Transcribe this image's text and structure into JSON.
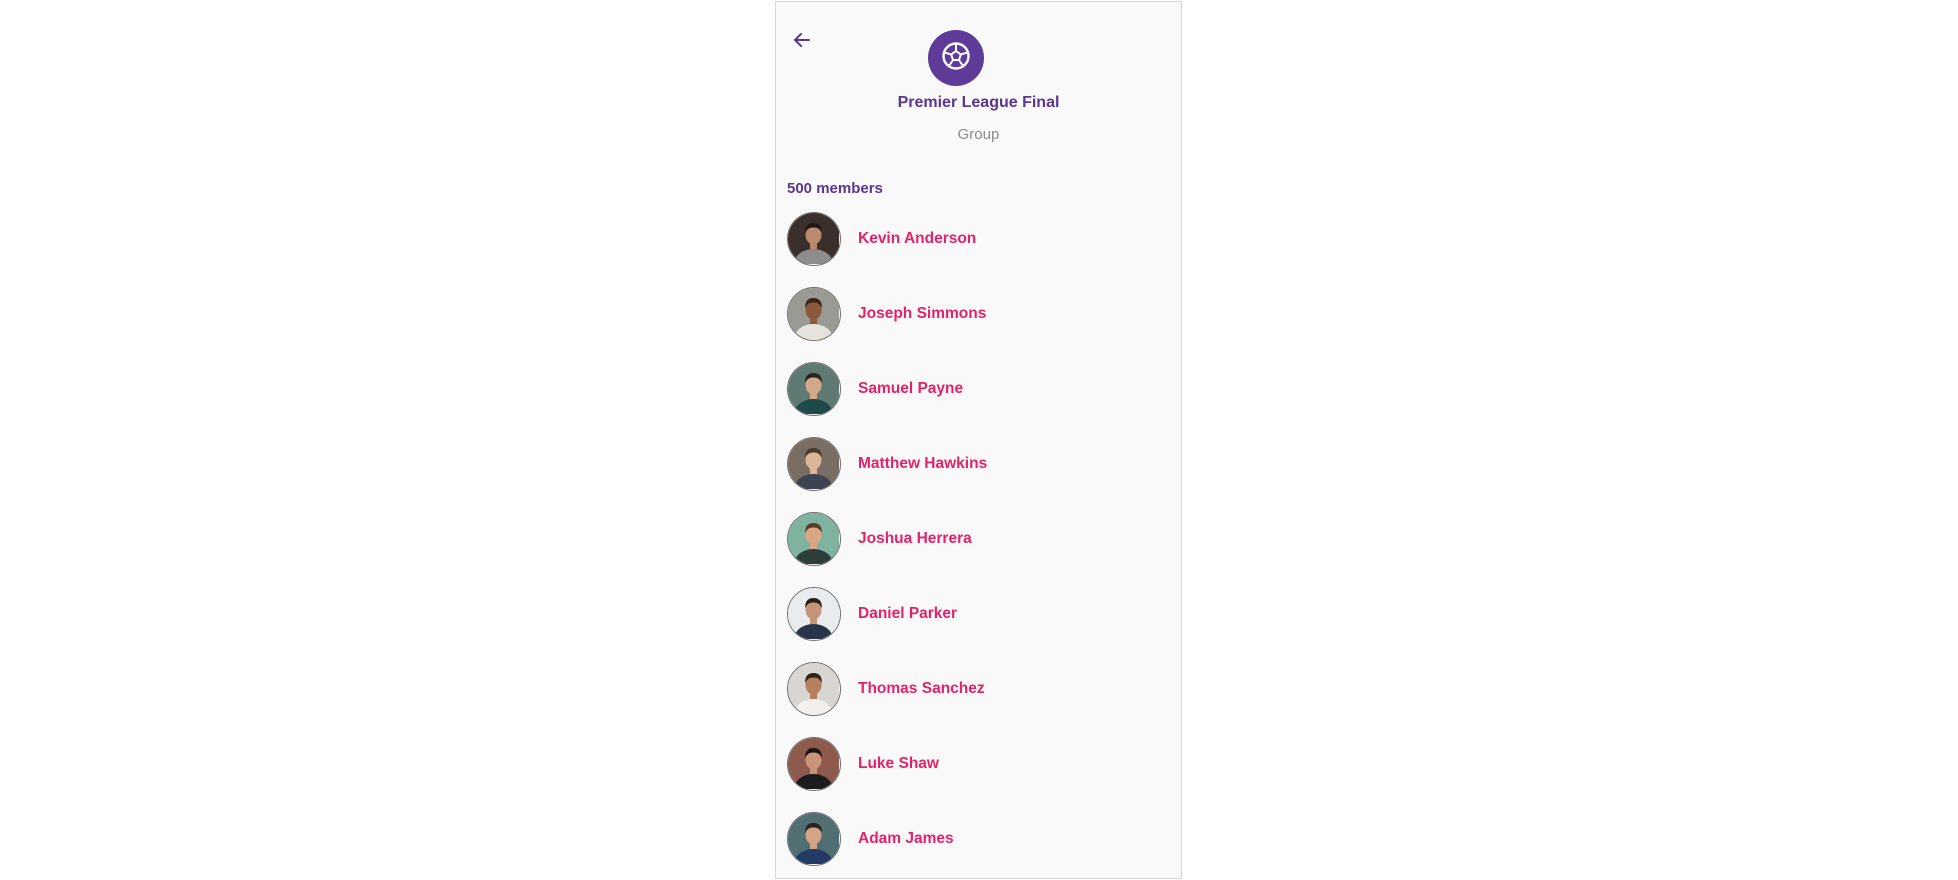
{
  "header": {
    "back_icon": "arrow-left-icon",
    "group_icon": "soccer-ball-icon",
    "title": "Premier League Final",
    "subtitle": "Group"
  },
  "members": {
    "count_label": "500 members",
    "items": [
      {
        "name": "Kevin Anderson",
        "bg": "#3b2f2c",
        "skin": "#b98a6e",
        "hair": "#1d1816",
        "shirt": "#8d8d8d"
      },
      {
        "name": "Joseph Simmons",
        "bg": "#9a9a94",
        "skin": "#8a5a3d",
        "hair": "#3a2618",
        "shirt": "#e6e2dc"
      },
      {
        "name": "Samuel Payne",
        "bg": "#5f7a73",
        "skin": "#d2a888",
        "hair": "#2a2420",
        "shirt": "#1f4a4a"
      },
      {
        "name": "Matthew Hawkins",
        "bg": "#7a6e64",
        "skin": "#dcb699",
        "hair": "#4a3a2c",
        "shirt": "#3c4452"
      },
      {
        "name": "Joshua Herrera",
        "bg": "#7fb3a0",
        "skin": "#d9a585",
        "hair": "#5a3a22",
        "shirt": "#2c3d3a"
      },
      {
        "name": "Daniel Parker",
        "bg": "#e9ecef",
        "skin": "#c69478",
        "hair": "#2a1f1a",
        "shirt": "#2a3448"
      },
      {
        "name": "Thomas Sanchez",
        "bg": "#d8d6d2",
        "skin": "#b57e5c",
        "hair": "#2c211b",
        "shirt": "#f2f0ec"
      },
      {
        "name": "Luke Shaw",
        "bg": "#8e5a4e",
        "skin": "#c99478",
        "hair": "#1a1512",
        "shirt": "#1c1c1e"
      },
      {
        "name": "Adam James",
        "bg": "#4f6f73",
        "skin": "#d4a486",
        "hair": "#2b221c",
        "shirt": "#243a66"
      }
    ]
  },
  "colors": {
    "accent_purple": "#5e3a99",
    "name_pink": "#e3226b",
    "muted_gray": "#8a8a8a",
    "screen_bg": "#f9f9fa"
  }
}
